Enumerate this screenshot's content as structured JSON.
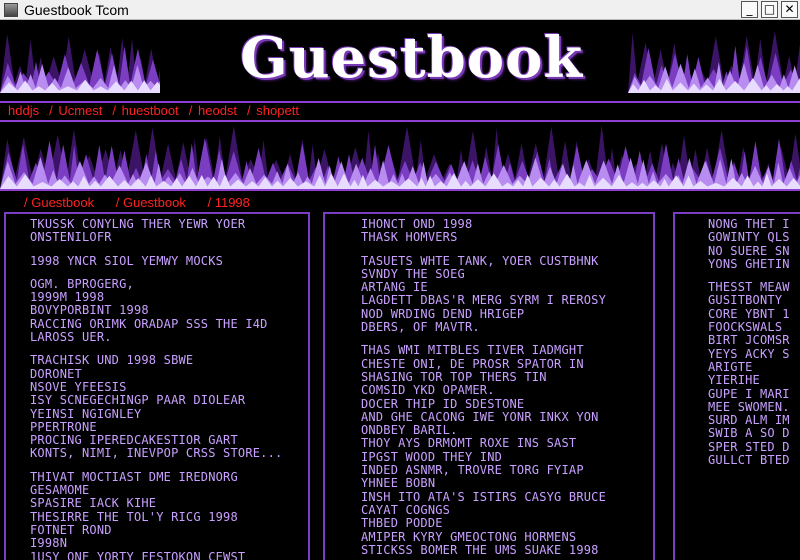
{
  "window": {
    "title": "Guestbook Tcom",
    "minimize": "_",
    "maximize": "□",
    "close": "✕"
  },
  "header": {
    "logo": "Guestbook"
  },
  "nav": {
    "items": [
      "hddjs",
      "Ucmest",
      "huestboot",
      "heodst",
      "shopett"
    ]
  },
  "breadcrumbs": [
    "Guestbook",
    "Guestbook",
    "11998"
  ],
  "colors": {
    "accent": "#8c3fd1",
    "link": "#ff2222",
    "text": "#c8a0ff",
    "background": "#000000"
  },
  "columns": [
    {
      "groups": [
        [
          "TKUSSK CONYLNG THER YEWR YOER",
          "ONSTENILOFR"
        ],
        [
          "1998 YNCR SIOL YEMWY MOCKS"
        ],
        [
          "OGM. BPROGERG,",
          "1999M 1998",
          "BOVYPORBINT 1998",
          "RACCING ORIMK ORADAP SSS THE I4D",
          "LAROSS UER."
        ],
        [
          "TRACHISK UND 1998 SBWE",
          "DORONET",
          "NSOVE YFEESIS",
          "ISY SCNEGECHINGP PAAR DIOLEAR",
          "YEINSI NGIGNLEY",
          "PPERTRONE",
          "PROCING IPEREDCAKESTIOR GART",
          "KONTS, NIMI, INEVPOP CRSS STORE..."
        ],
        [
          "THIVAT MOCTIAST DME IREDNORG",
          "GESAMOME",
          "SPASIRE IACK KIHE",
          "THESIRRE THE TOL'Y RICG 1998",
          "FOTNET ROND",
          "I998N",
          "1USY ONE YORTY FESTOKON CEWST"
        ]
      ]
    },
    {
      "groups": [
        [
          "IHONCT OND 1998",
          "THASK HOMVERS"
        ],
        [
          "TASUETS WHTE TANK, YOER CUSTBHNK",
          "SVNDY  THE SOEG",
          "ARTANG IE",
          "LAGDETT DBAS'R MERG SYRM I REROSY",
          "NOD WRDING DEND HRIGEP",
          "DBERS, OF MAVTR."
        ],
        [
          "THAS WMI MITBLES TIVER IADMGHT",
          "CHESTE ONI, DE PROSR SPATOR IN",
          "SHASING  TOR TOP THERS TIN",
          "COMSID YKD  OPAMER.",
          "DOCER THIP ID SDESTONE",
          "AND GHE CACONG IWE YONR INKX YON",
          "ONDBEY BARIL.",
          "THOY AYS DRMOMT ROXE INS SAST",
          "IPGST WOOD THEY IND",
          "INDED ASNMR, TROVRE TORG FYIAP",
          "YHNEE BOBN",
          "INSH ITO ATA'S ISTIRS CASYG BRUCE",
          "CAYAT COGNGS",
          "THBED PODDE",
          "AMIPER KYRY GMEOCTONG HORMENS",
          "STICKSS BOMER THE UMS SUAKE 1998"
        ]
      ]
    },
    {
      "groups": [
        [
          "NONG THET I",
          "GOWINTY QLS",
          "NO SUERE SN",
          "YONS GHETIN"
        ],
        [
          "THESST MEAW",
          "GUSITBONTY",
          "CORE YBNT 1",
          "FOOCKSWALS",
          "BIRT JCOMSR",
          "YEYS ACKY S",
          "ARIGTE",
          "  YIERIHE",
          "GUPE I MARI",
          "MEE SWOMEN.",
          "SURD ALM IM",
          "SWIB A SO D",
          "SPER STED D",
          "GULLCT BTED"
        ]
      ]
    }
  ]
}
